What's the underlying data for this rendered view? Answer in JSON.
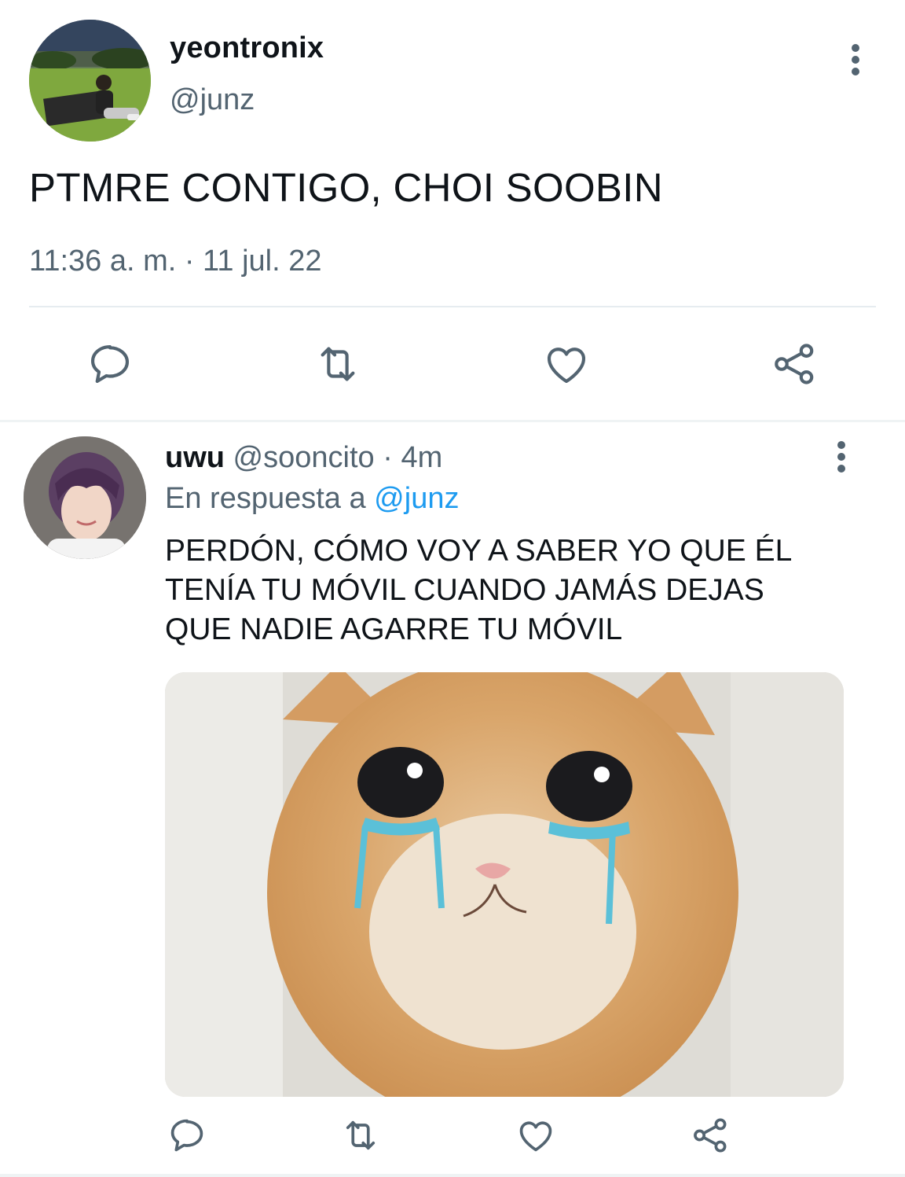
{
  "main_tweet": {
    "display_name": "yeontronix",
    "handle": "@junz",
    "text": "PTMRE CONTIGO, CHOI SOOBIN",
    "timestamp": "11:36 a. m. · 11 jul. 22",
    "avatar_icon": "profile-photo-person-sitting-on-grass",
    "actions": [
      "reply-icon",
      "retweet-icon",
      "like-icon",
      "share-icon"
    ]
  },
  "reply_tweet": {
    "display_name": "uwu",
    "handle": "@sooncito",
    "separator": "·",
    "age": "4m",
    "reply_to_prefix": "En respuesta a",
    "reply_to_handle": "@junz",
    "text": "PERDÓN, CÓMO VOY A SABER YO QUE ÉL\nTENÍA TU MÓVIL CUANDO JAMÁS DEJAS\nQUE NADIE AGARRE TU MÓVIL",
    "avatar_icon": "profile-photo-purple-hair",
    "media_icon": "crying-kitten-meme-image",
    "actions": [
      "reply-icon",
      "retweet-icon",
      "like-icon",
      "share-icon"
    ]
  },
  "colors": {
    "text": "#0f1419",
    "muted": "#536471",
    "link": "#1d9bf0",
    "divider": "#e6ecf0"
  }
}
